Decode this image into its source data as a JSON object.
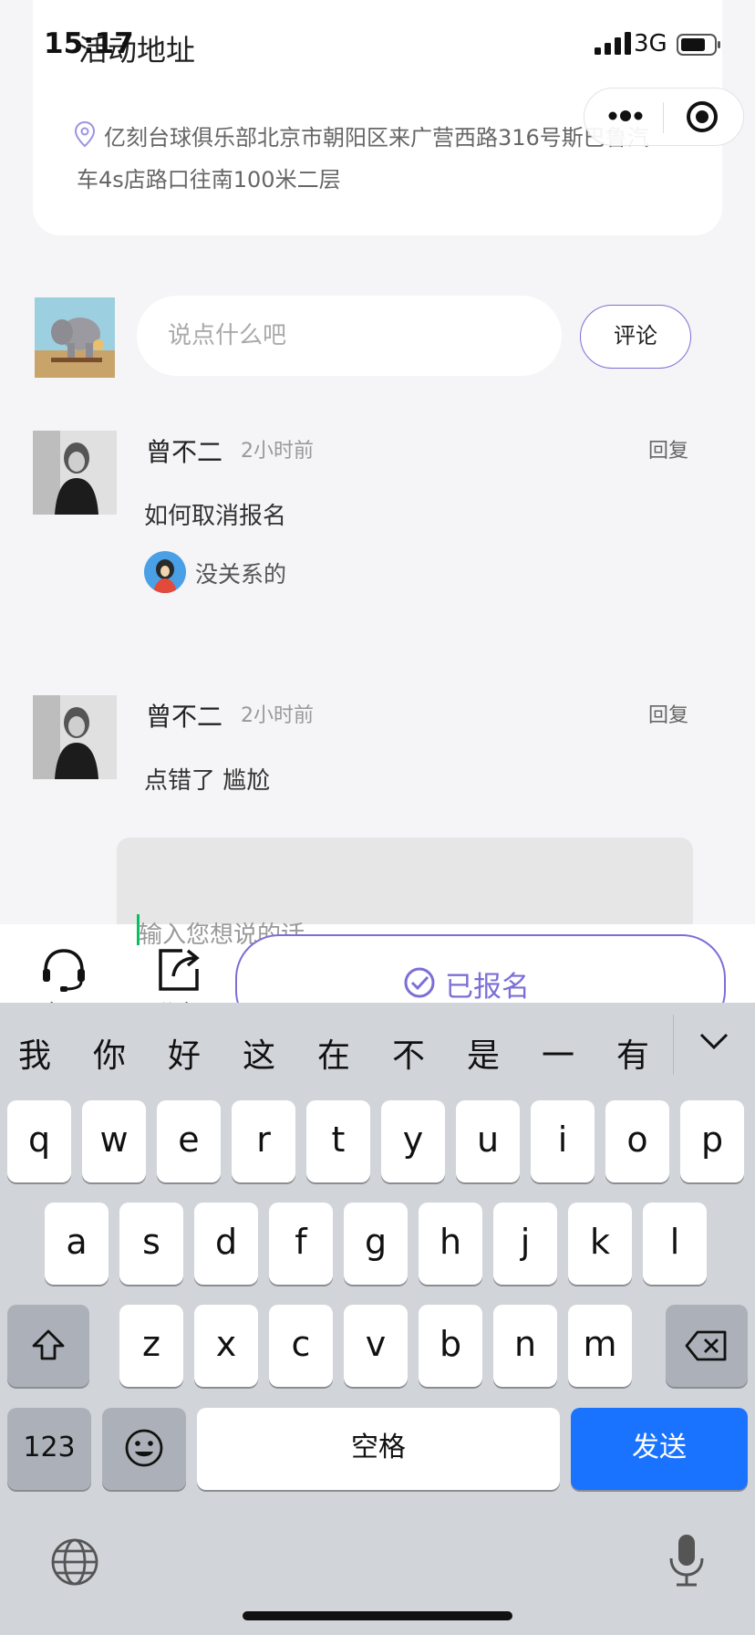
{
  "status_bar": {
    "time": "15:17",
    "network": "3G"
  },
  "address": {
    "title": "活动地址",
    "text": "亿刻台球俱乐部北京市朝阳区来广营西路316号斯巴鲁汽车4s店路口往南100米二层"
  },
  "comment_input": {
    "placeholder": "说点什么吧",
    "button": "评论"
  },
  "comments": [
    {
      "name": "曾不二",
      "time": "2小时前",
      "reply": "回复",
      "text": "如何取消报名",
      "sub_reply": {
        "text": "没关系的"
      }
    },
    {
      "name": "曾不二",
      "time": "2小时前",
      "reply": "回复",
      "text": "点错了 尴尬"
    }
  ],
  "reply_box": {
    "placeholder": "输入您想说的话"
  },
  "bottom_bar": {
    "service_label": "客服",
    "share_label": "分享",
    "signed_label": "已报名"
  },
  "keyboard": {
    "candidates": [
      "我",
      "你",
      "好",
      "这",
      "在",
      "不",
      "是",
      "一",
      "有"
    ],
    "row1": [
      "q",
      "w",
      "e",
      "r",
      "t",
      "y",
      "u",
      "i",
      "o",
      "p"
    ],
    "row2": [
      "a",
      "s",
      "d",
      "f",
      "g",
      "h",
      "j",
      "k",
      "l"
    ],
    "row3": [
      "z",
      "x",
      "c",
      "v",
      "b",
      "n",
      "m"
    ],
    "numbers_key": "123",
    "space_key": "空格",
    "send_key": "发送"
  },
  "colors": {
    "accent": "#7b6fd6",
    "send": "#1a73ff",
    "cursor": "#07c160"
  }
}
